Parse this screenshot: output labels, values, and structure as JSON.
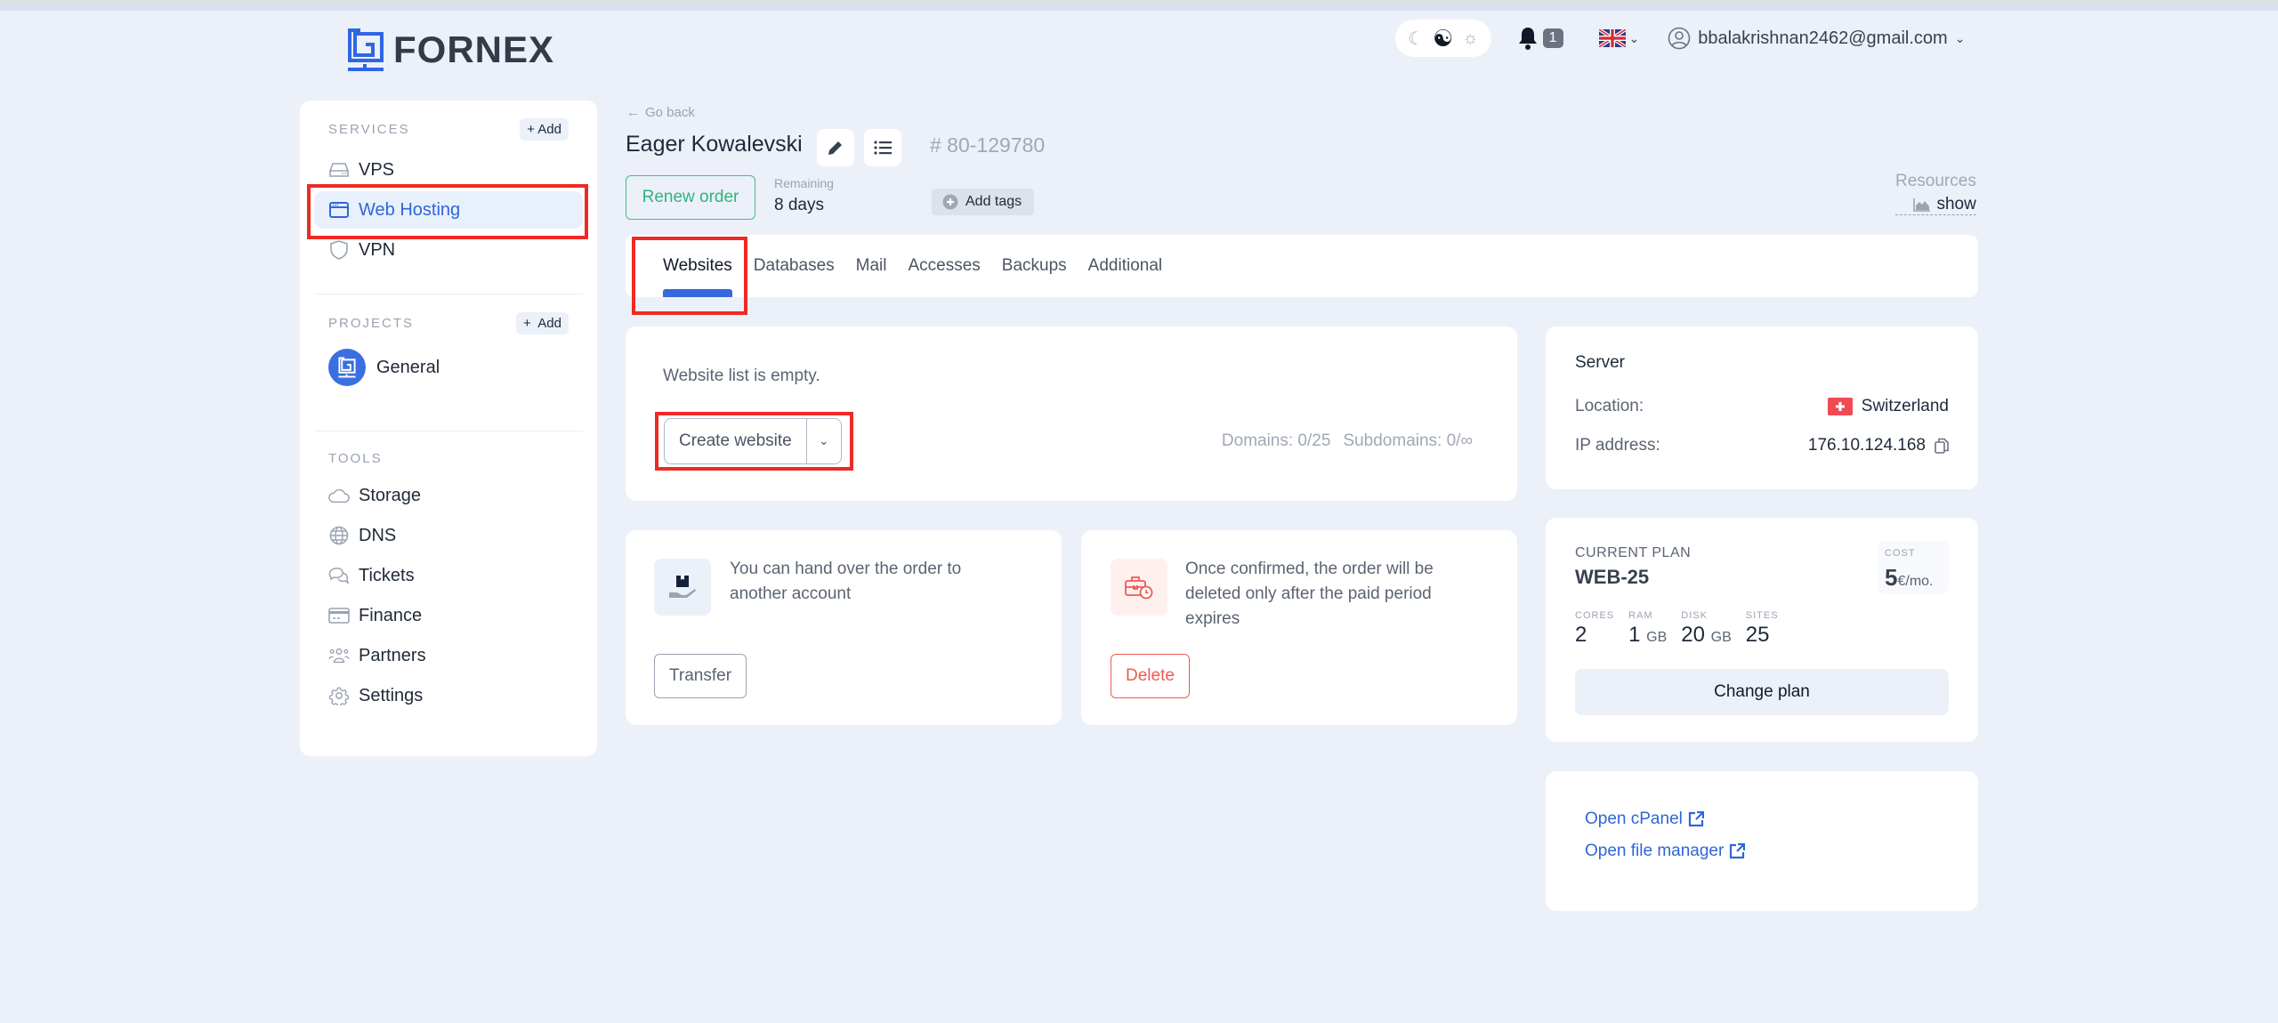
{
  "brand": {
    "name": "FORNEX",
    "accent": "#2f66d6"
  },
  "header": {
    "theme_options": [
      "moon-icon",
      "yin-yang-icon",
      "sun-icon"
    ],
    "notifications_count": "1",
    "language": "EN-GB",
    "user_email": "bbalakrishnan2462@gmail.com"
  },
  "sidebar": {
    "services": {
      "title": "SERVICES",
      "add_label": "Add",
      "items": [
        {
          "label": "VPS",
          "icon": "server-icon"
        },
        {
          "label": "Web Hosting",
          "icon": "browser-window-icon",
          "active": true
        },
        {
          "label": "VPN",
          "icon": "shield-icon"
        }
      ]
    },
    "projects": {
      "title": "PROJECTS",
      "add_label": "Add",
      "items": [
        {
          "label": "General"
        }
      ]
    },
    "tools": {
      "title": "TOOLS",
      "items": [
        {
          "label": "Storage",
          "icon": "cloud-icon"
        },
        {
          "label": "DNS",
          "icon": "globe-icon"
        },
        {
          "label": "Tickets",
          "icon": "chat-icon"
        },
        {
          "label": "Finance",
          "icon": "credit-card-icon"
        },
        {
          "label": "Partners",
          "icon": "users-icon"
        },
        {
          "label": "Settings",
          "icon": "gear-icon"
        }
      ]
    }
  },
  "order": {
    "go_back": "Go back",
    "title": "Eager Kowalevski",
    "id": "# 80-129780",
    "renew_label": "Renew order",
    "remaining_label": "Remaining",
    "remaining_value": "8 days",
    "add_tags_label": "Add tags",
    "resources_label": "Resources",
    "resources_show": "show"
  },
  "tabs": [
    {
      "label": "Websites",
      "active": true
    },
    {
      "label": "Databases"
    },
    {
      "label": "Mail"
    },
    {
      "label": "Accesses"
    },
    {
      "label": "Backups"
    },
    {
      "label": "Additional"
    }
  ],
  "websites": {
    "empty_text": "Website list is empty.",
    "create_label": "Create website",
    "domains": "Domains: 0/25",
    "subdomains": "Subdomains: 0/∞"
  },
  "transfer": {
    "text": "You can hand over the order to another account",
    "button": "Transfer"
  },
  "delete": {
    "text": "Once confirmed, the order will be deleted only after the paid period expires",
    "button": "Delete"
  },
  "server": {
    "title": "Server",
    "location_label": "Location:",
    "location_value": "Switzerland",
    "ip_label": "IP address:",
    "ip_value": "176.10.124.168"
  },
  "plan": {
    "label": "CURRENT PLAN",
    "name": "WEB-25",
    "cost_label": "COST",
    "cost_value": "5",
    "cost_unit": "€/mo.",
    "specs": [
      {
        "label": "CORES",
        "value": "2",
        "unit": ""
      },
      {
        "label": "RAM",
        "value": "1",
        "unit": "GB"
      },
      {
        "label": "DISK",
        "value": "20",
        "unit": "GB"
      },
      {
        "label": "SITES",
        "value": "25",
        "unit": ""
      }
    ],
    "change_label": "Change plan"
  },
  "links": {
    "cpanel": "Open cPanel",
    "file_manager": "Open file manager"
  }
}
